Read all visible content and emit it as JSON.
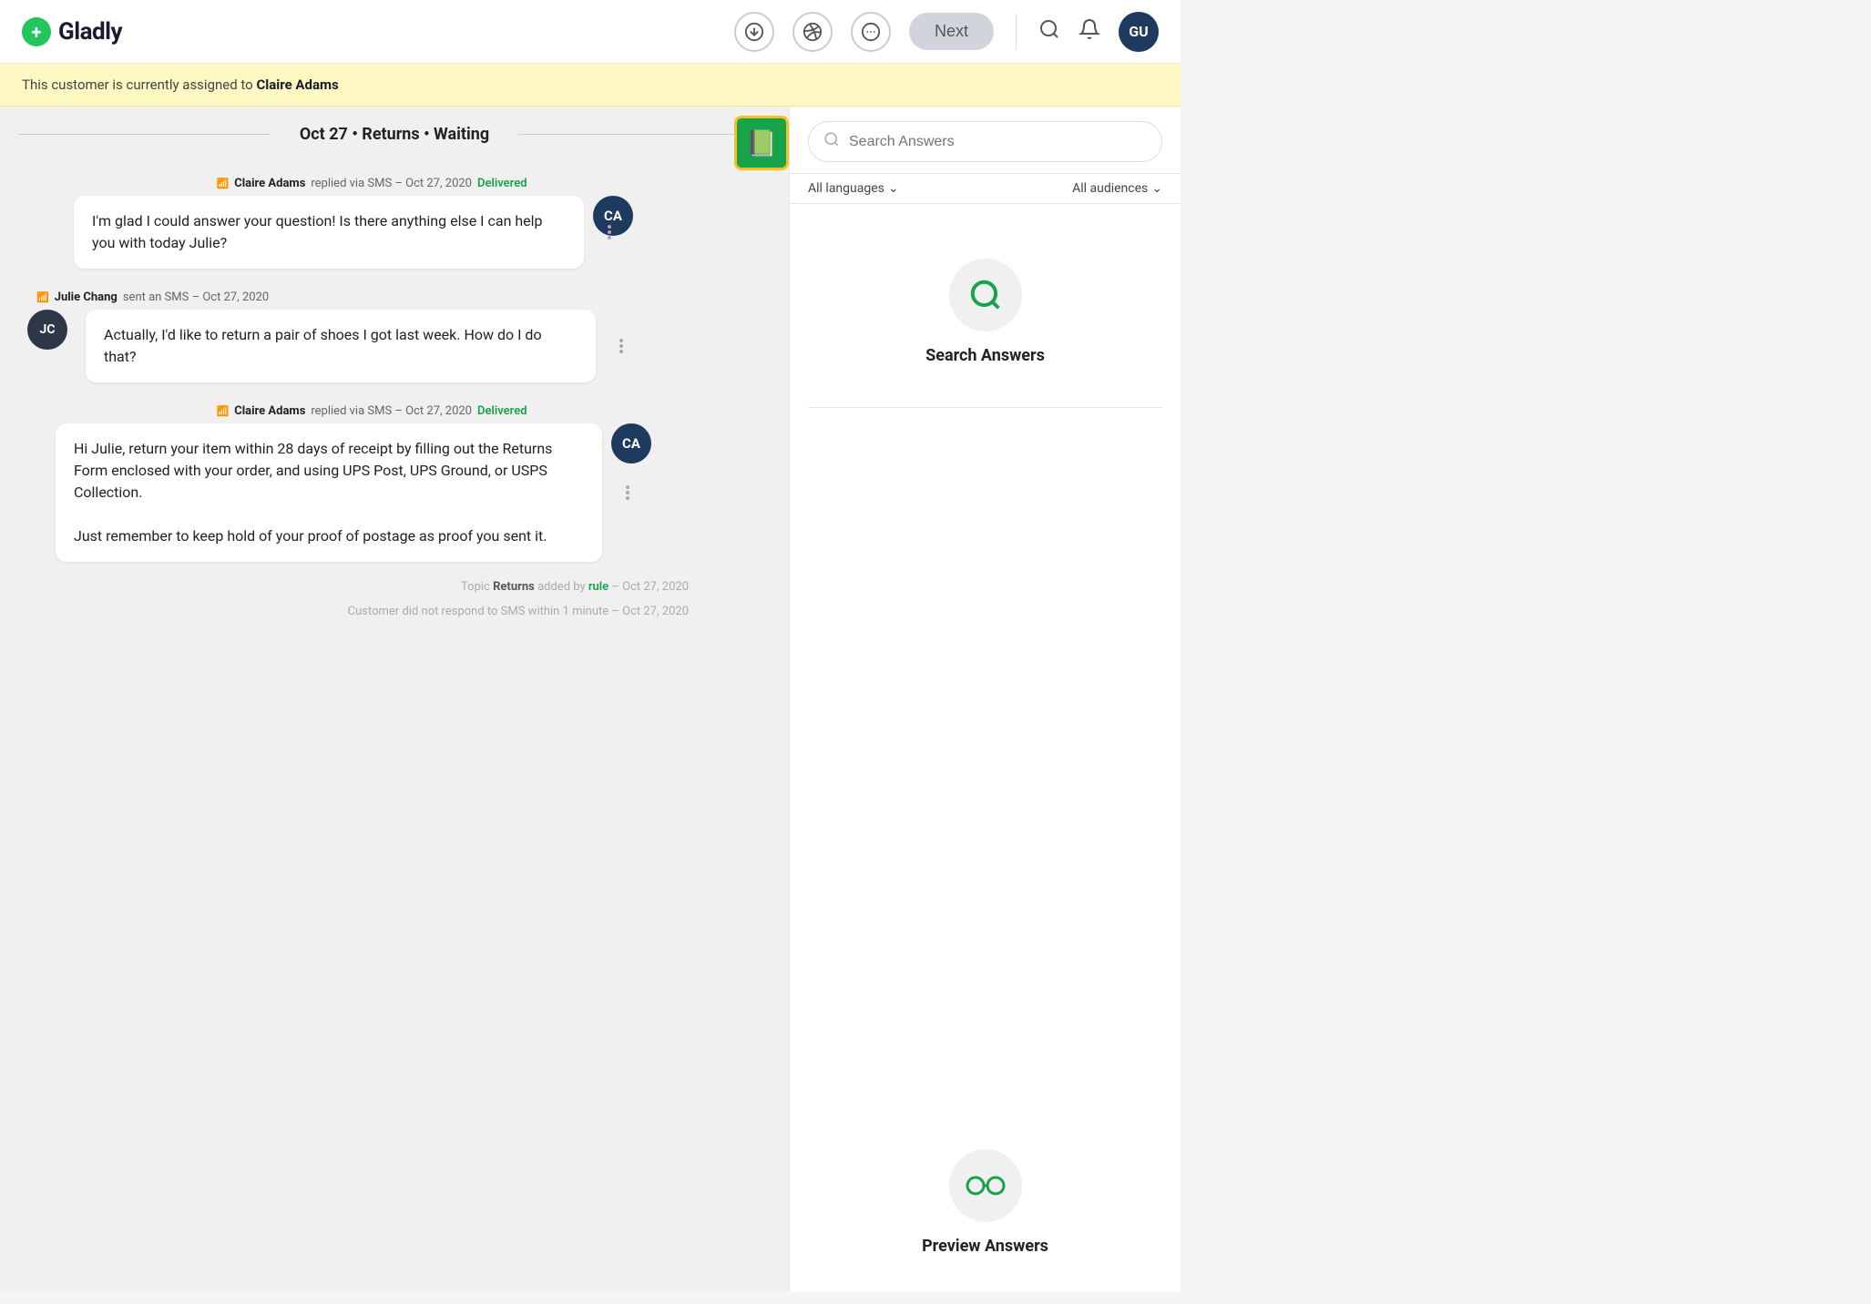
{
  "header": {
    "logo_text": "Gladly",
    "next_label": "Next",
    "user_initials": "GU"
  },
  "banner": {
    "text_before": "This customer is currently assigned to ",
    "agent_name": "Claire Adams"
  },
  "chat": {
    "thread_title": "Oct 27 • Returns • Waiting",
    "messages": [
      {
        "type": "agent_meta",
        "agent": "Claire Adams",
        "channel": "SMS",
        "date": "Oct 27, 2020",
        "status": "Delivered"
      },
      {
        "type": "agent_bubble",
        "avatar": "CA",
        "text": "I'm glad I could answer your question! Is there anything else I can help you with today Julie?"
      },
      {
        "type": "customer_meta",
        "customer": "Julie Chang",
        "channel": "SMS",
        "date": "Oct 27, 2020"
      },
      {
        "type": "customer_bubble",
        "avatar": "JC",
        "text": "Actually, I'd like to return a pair of shoes I got last week. How do I do that?"
      },
      {
        "type": "agent_meta",
        "agent": "Claire Adams",
        "channel": "SMS",
        "date": "Oct 27, 2020",
        "status": "Delivered"
      },
      {
        "type": "agent_bubble",
        "avatar": "CA",
        "text": "Hi Julie, return your item within 28 days of receipt by filling out the Returns Form enclosed with your order, and using UPS Post, UPS Ground, or USPS Collection.\n\nJust remember to keep hold of your proof of postage as proof you sent it."
      }
    ],
    "system_msgs": [
      "Topic Returns added by rule – Oct 27, 2020",
      "Customer did not respond to SMS within 1 minute – Oct 27, 2020"
    ],
    "topic_name": "Returns",
    "rule_link": "rule"
  },
  "answers_panel": {
    "search_placeholder": "Search Answers",
    "filter_language": "All languages",
    "filter_audience": "All audiences",
    "empty_title": "Search Answers",
    "preview_title": "Preview Answers"
  }
}
